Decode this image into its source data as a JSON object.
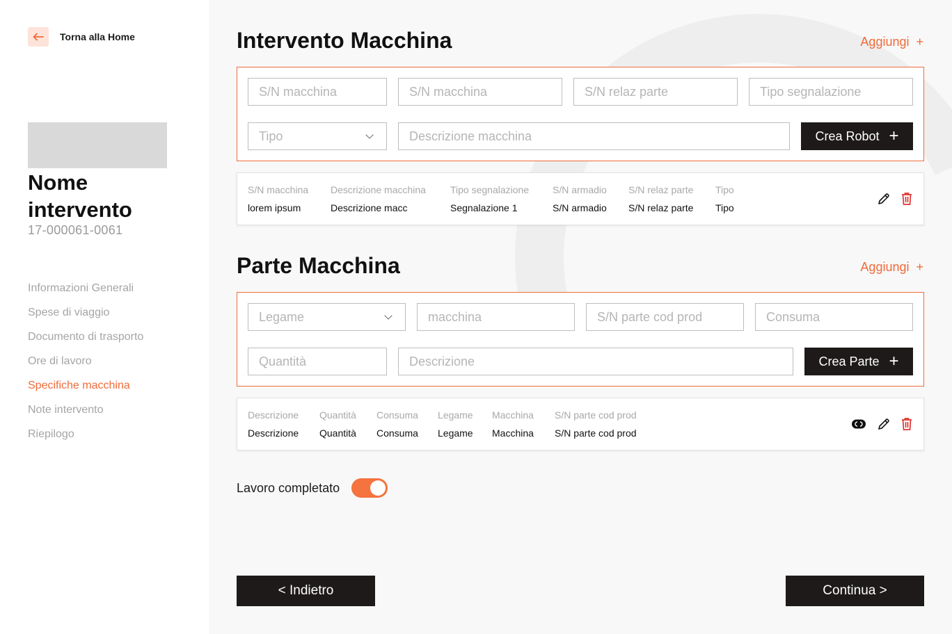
{
  "sidebar": {
    "back_label": "Torna alla Home",
    "intervention_name": "Nome intervento",
    "intervention_code": "17-000061-0061",
    "nav_items": [
      "Informazioni Generali",
      "Spese di viaggio",
      "Documento di trasporto",
      "Ore di lavoro",
      "Specifiche macchina",
      "Note intervento",
      "Riepilogo"
    ],
    "active_item": "Specifiche macchina"
  },
  "machine_section": {
    "title": "Intervento Macchina",
    "add_label": "Aggiungi",
    "fields": {
      "sn_machine_1": "S/N macchina",
      "sn_machine_2": "S/N macchina",
      "sn_relaz_parte": "S/N relaz parte",
      "tipo_segnalazione": "Tipo segnalazione",
      "tipo": "Tipo",
      "descrizione": "Descrizione macchina"
    },
    "create_label": "Crea Robot",
    "row": {
      "headers": [
        "S/N macchina",
        "Descrizione macchina",
        "Tipo segnalazione",
        "S/N armadio",
        "S/N relaz parte",
        "Tipo"
      ],
      "values": [
        "lorem ipsum",
        "Descrizione macc",
        "Segnalazione 1",
        "S/N armadio",
        "S/N relaz parte",
        "Tipo"
      ]
    }
  },
  "part_section": {
    "title": "Parte Macchina",
    "add_label": "Aggiungi",
    "fields": {
      "legame": "Legame",
      "macchina": "macchina",
      "sn_parte": "S/N parte cod prod",
      "consuma": "Consuma",
      "quantita": "Quantità",
      "descrizione": "Descrizione"
    },
    "create_label": "Crea Parte",
    "row": {
      "headers": [
        "Descrizione",
        "Quantità",
        "Consuma",
        "Legame",
        "Macchina",
        "S/N parte cod prod"
      ],
      "values": [
        "Descrizione",
        "Quantità",
        "Consuma",
        "Legame",
        "Macchina",
        "S/N parte cod prod"
      ]
    }
  },
  "work_completed": {
    "label": "Lavoro completato",
    "on": true
  },
  "footer": {
    "back_label": "< Indietro",
    "continue_label": "Continua >"
  },
  "colors": {
    "accent": "#f06b39",
    "dark": "#1e1a1a",
    "delete": "#e0322e"
  }
}
